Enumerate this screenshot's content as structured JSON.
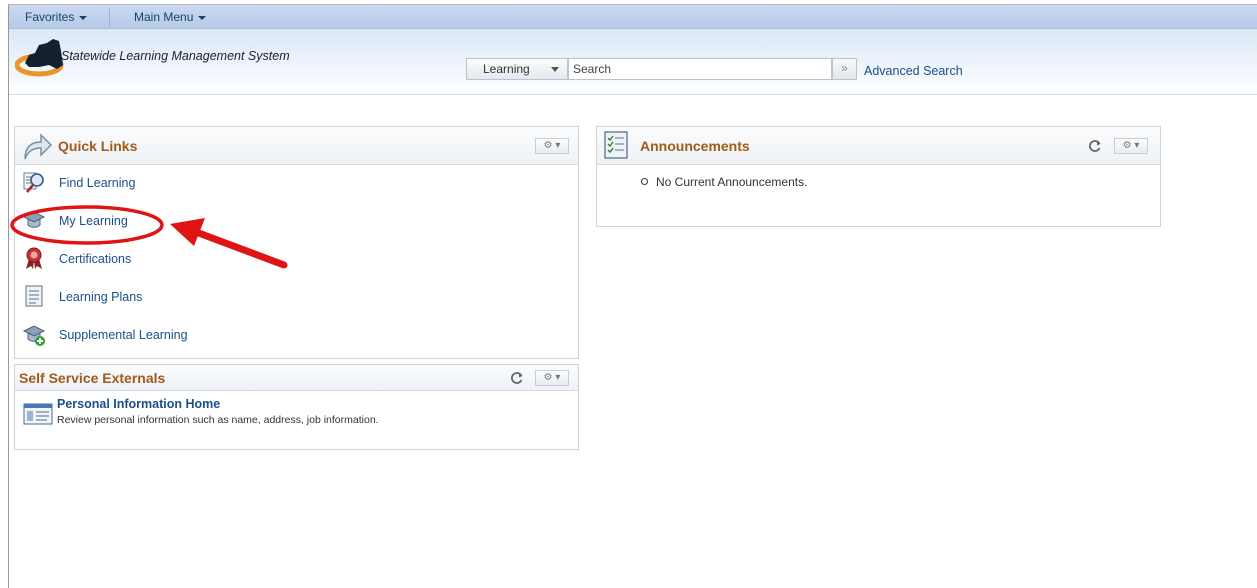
{
  "menubar": {
    "favorites_label": "Favorites",
    "main_menu_label": "Main Menu"
  },
  "header": {
    "app_title": "Statewide Learning Management System",
    "search_scope": "Learning",
    "search_placeholder": "Search",
    "search_go_glyph": "»",
    "advanced_search_label": "Advanced Search"
  },
  "quick_links": {
    "title": "Quick Links",
    "options_glyph": "⚙ ▾",
    "items": [
      {
        "label": "Find Learning",
        "icon": "magnifier-document-icon"
      },
      {
        "label": "My Learning",
        "icon": "graduation-cap-icon"
      },
      {
        "label": "Certifications",
        "icon": "award-ribbon-icon"
      },
      {
        "label": "Learning Plans",
        "icon": "checklist-icon"
      },
      {
        "label": "Supplemental Learning",
        "icon": "graduation-cap-add-icon"
      }
    ]
  },
  "self_service": {
    "title": "Self Service Externals",
    "options_glyph": "⚙ ▾",
    "link_title": "Personal Information Home",
    "link_description": "Review personal information such as name, address, job information."
  },
  "announcements": {
    "title": "Announcements",
    "options_glyph": "⚙ ▾",
    "items": [
      "No Current Announcements."
    ]
  },
  "colors": {
    "pagelet_title": "#a25a1a",
    "link": "#1b4f8a",
    "annotation_red": "#e01414"
  }
}
